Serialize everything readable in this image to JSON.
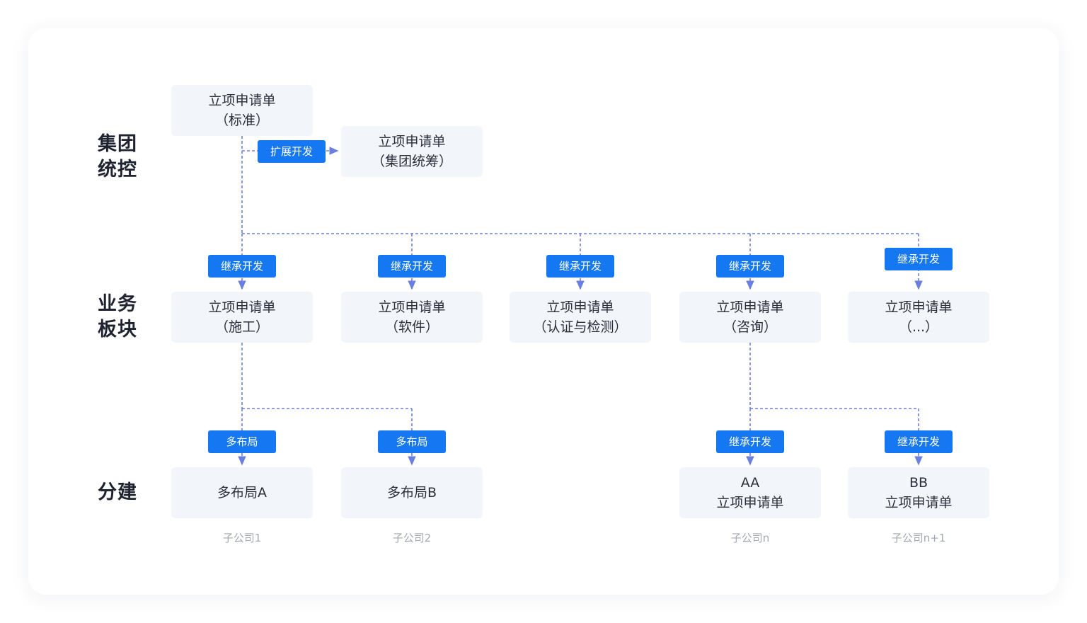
{
  "rows": {
    "group": [
      "集团",
      "统控"
    ],
    "business": [
      "业务",
      "板块"
    ],
    "branch": [
      "分建"
    ]
  },
  "group_boxes": {
    "standard": [
      "立项申请单",
      "（标准）"
    ],
    "coordinated": [
      "立项申请单",
      "（集团统筹）"
    ]
  },
  "extend_tag": "扩展开发",
  "business_tags": [
    "继承开发",
    "继承开发",
    "继承开发",
    "继承开发",
    "继承开发"
  ],
  "business_boxes": [
    [
      "立项申请单",
      "（施工）"
    ],
    [
      "立项申请单",
      "（软件）"
    ],
    [
      "立项申请单",
      "（认证与检测）"
    ],
    [
      "立项申请单",
      "（咨询）"
    ],
    [
      "立项申请单",
      "（...）"
    ]
  ],
  "branch_tags": [
    "多布局",
    "多布局",
    "继承开发",
    "继承开发"
  ],
  "branch_boxes": [
    [
      "多布局A"
    ],
    [
      "多布局B"
    ],
    [
      "AA",
      "立项申请单"
    ],
    [
      "BB",
      "立项申请单"
    ]
  ],
  "captions": [
    "子公司1",
    "子公司2",
    "子公司n",
    "子公司n+1"
  ],
  "colors": {
    "connector": "#6b7fe0",
    "tag_bg": "#1677f2",
    "box_bg": "#f2f5fa",
    "caption": "#a3a8b3"
  }
}
